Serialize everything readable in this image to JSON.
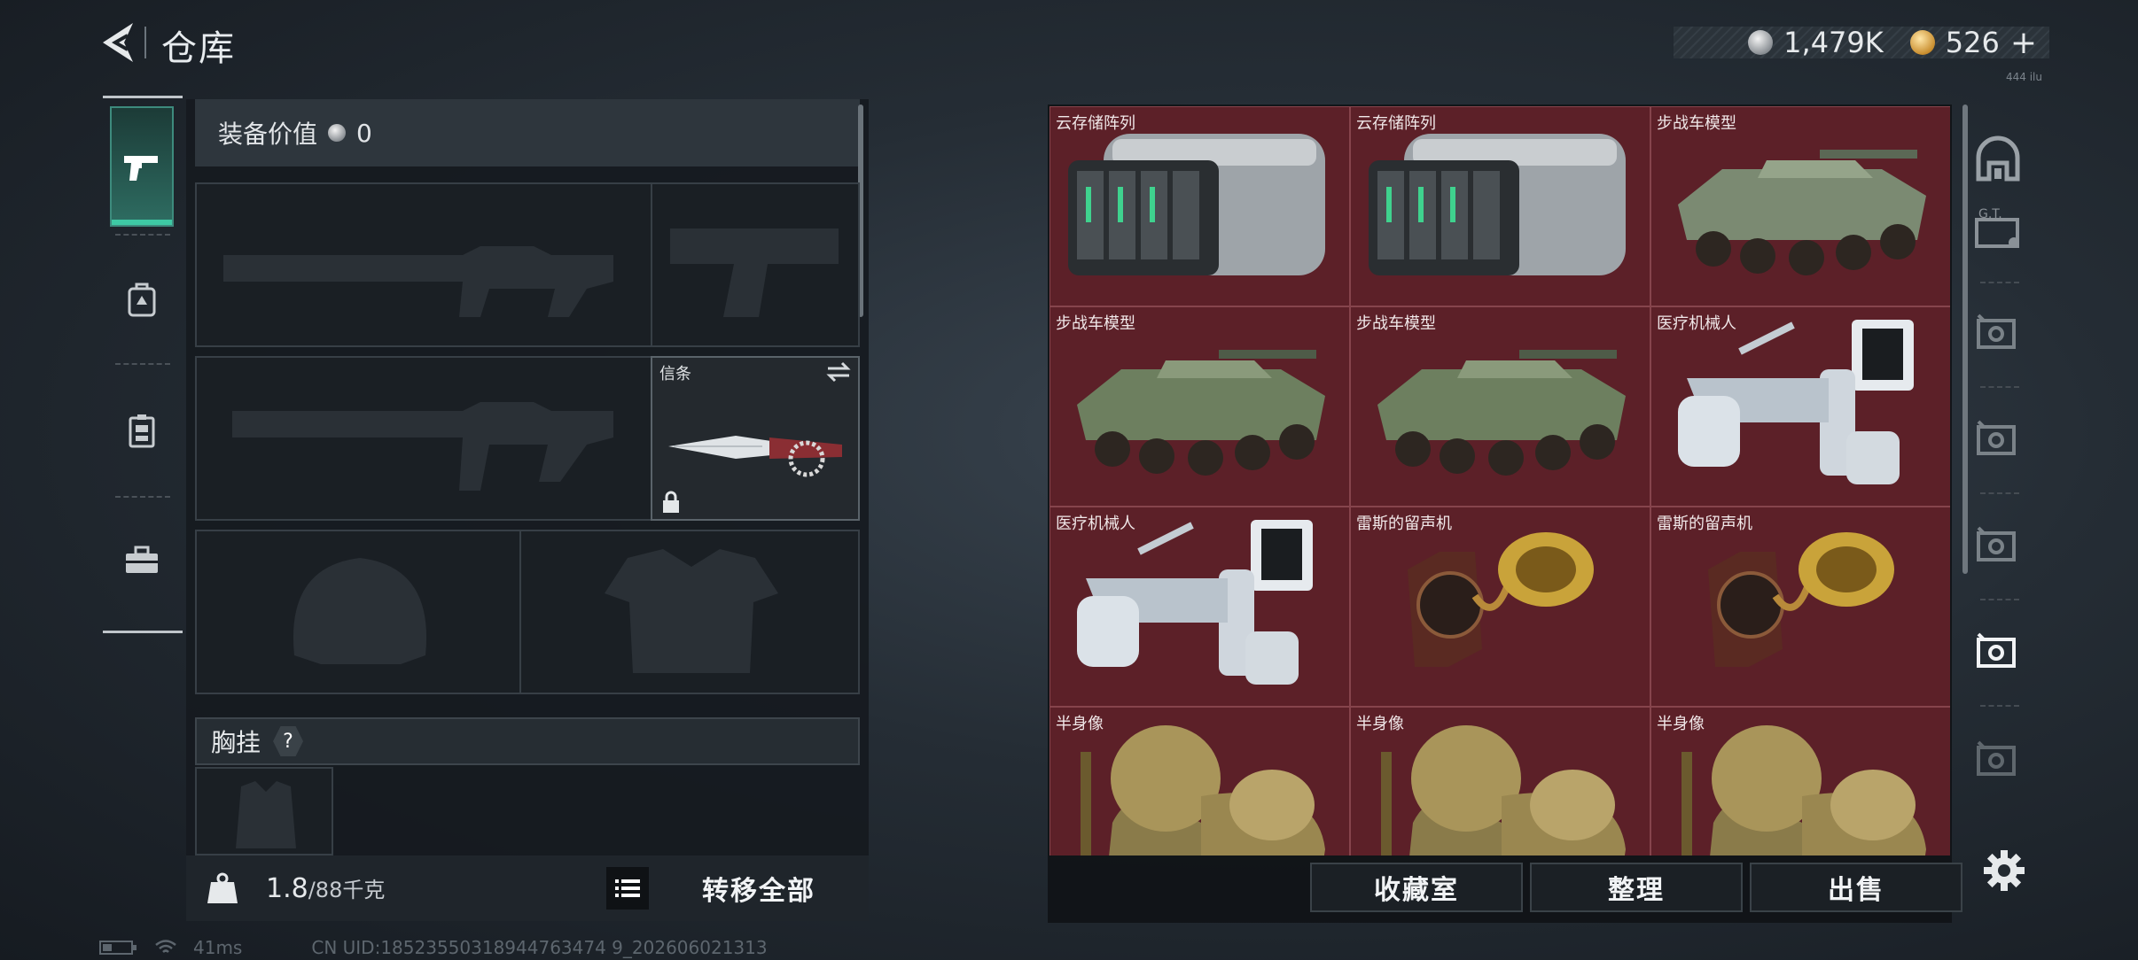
{
  "header": {
    "title": "仓库",
    "currency_silver": "1,479K",
    "currency_gold": "526",
    "currency_plus": "+",
    "currency_fine_text": "444 ilu"
  },
  "loadout": {
    "equip_value_label": "装备价值",
    "equip_value": "0",
    "knife_slot_label": "信条",
    "chest_rig_label": "胸挂",
    "chest_rig_help": "?",
    "weight_current": "1.8",
    "weight_limit": "/88千克",
    "kg_icon_text": "KG",
    "transfer_all": "转移全部"
  },
  "storage": {
    "items": [
      {
        "label": "云存储阵列",
        "icon": "server-array"
      },
      {
        "label": "云存储阵列",
        "icon": "server-array"
      },
      {
        "label": "步战车模型",
        "icon": "ifv-model"
      },
      {
        "label": "步战车模型",
        "icon": "ifv-model"
      },
      {
        "label": "步战车模型",
        "icon": "ifv-model"
      },
      {
        "label": "医疗机械人",
        "icon": "medical-robot"
      },
      {
        "label": "医疗机械人",
        "icon": "medical-robot"
      },
      {
        "label": "雷斯的留声机",
        "icon": "gramophone"
      },
      {
        "label": "雷斯的留声机",
        "icon": "gramophone"
      },
      {
        "label": "半身像",
        "icon": "bust"
      },
      {
        "label": "半身像",
        "icon": "bust"
      },
      {
        "label": "半身像",
        "icon": "bust"
      }
    ],
    "actions": {
      "collection": "收藏室",
      "organize": "整理",
      "sell": "出售"
    }
  },
  "status": {
    "ping": "41ms",
    "uid": "CN UID:18523550318944763474 9_202606021313"
  },
  "colors": {
    "item_bg": "#5c2028",
    "active_tab": "#3ec9a4",
    "panel_bg": "#1a1f24"
  }
}
